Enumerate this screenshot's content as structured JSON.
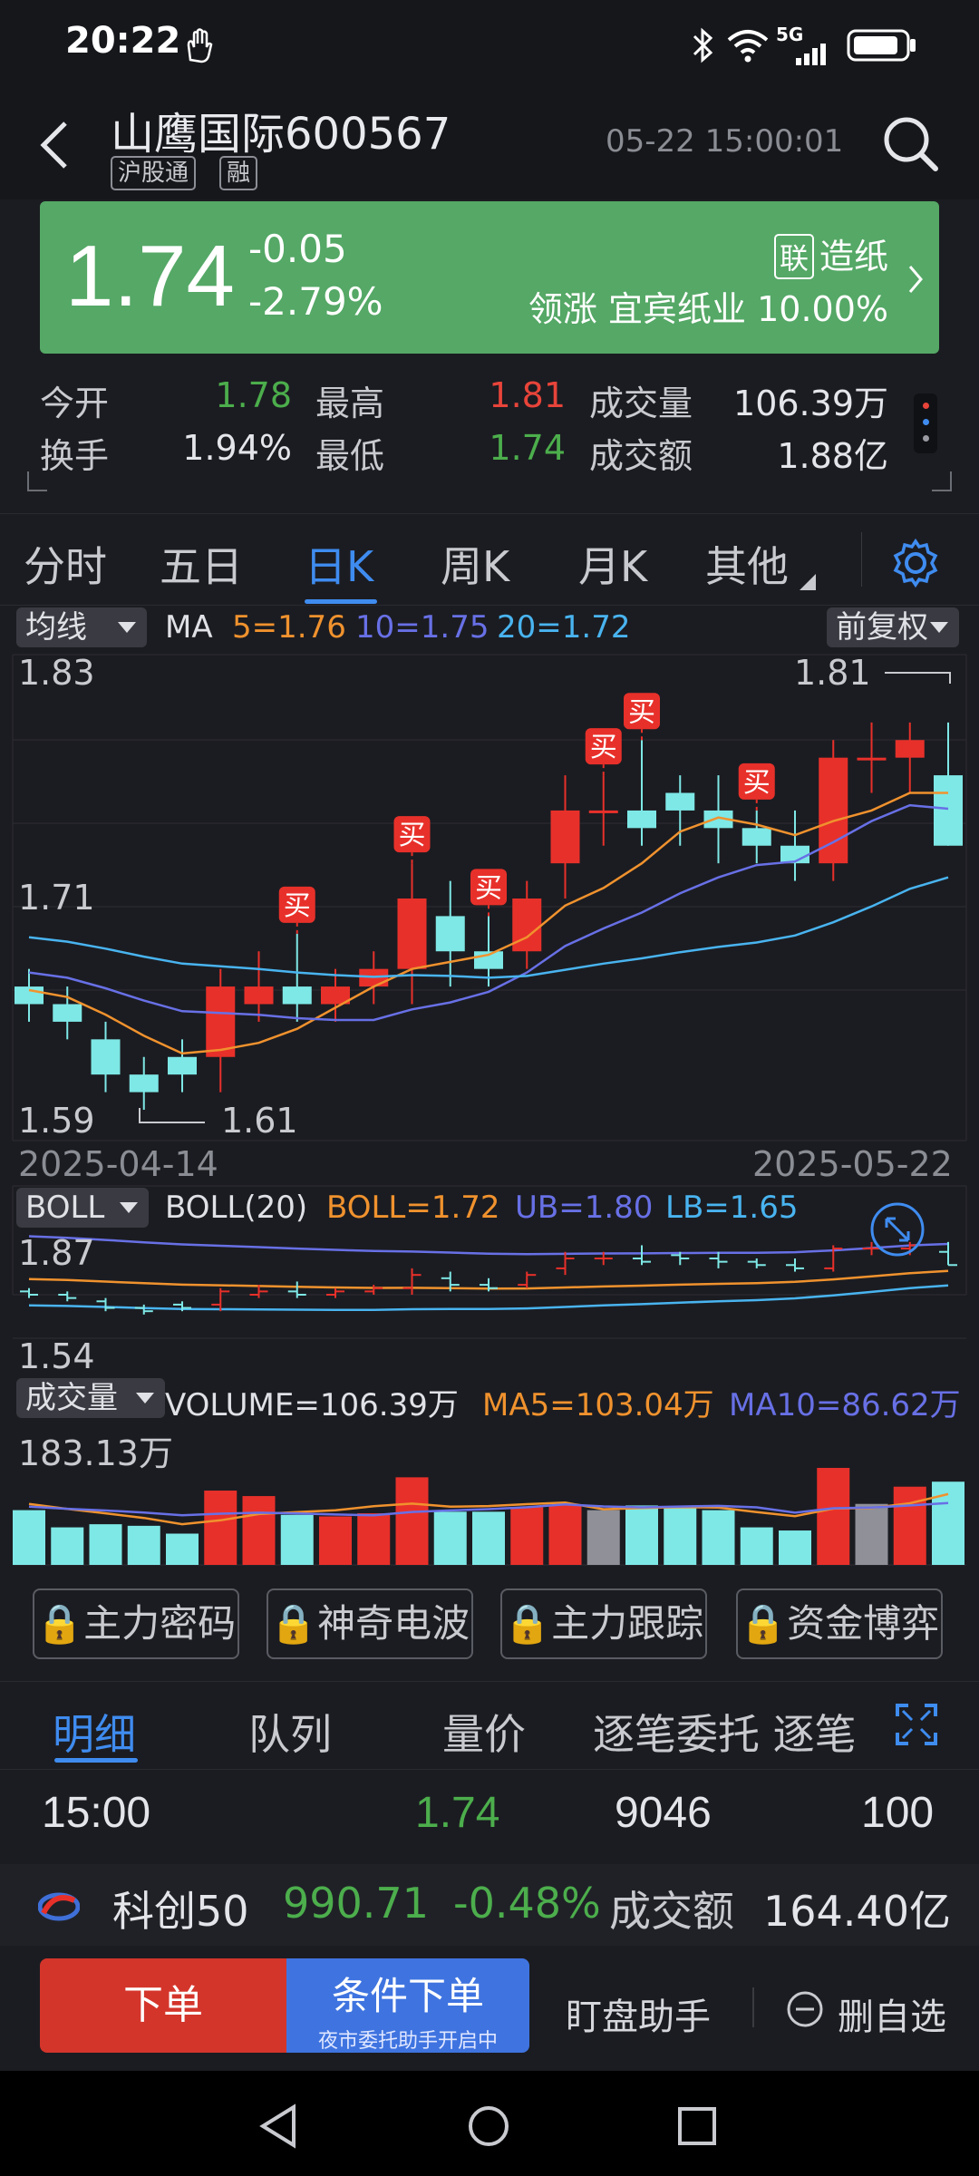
{
  "status_bar": {
    "time": "20:22",
    "network": "5G"
  },
  "header": {
    "stock_name_code": "山鹰国际600567",
    "tag_hgt": "沪股通",
    "tag_rong": "融",
    "datetime": "05-22 15:00:01"
  },
  "price": {
    "last": "1.74",
    "change": "-0.05",
    "change_pct": "-2.79%",
    "sector_tag": "联",
    "sector": "造纸",
    "lead_label": "领涨",
    "lead_stock": "宜宾纸业",
    "lead_pct": "10.00%"
  },
  "stats": {
    "open_label": "今开",
    "open": "1.78",
    "high_label": "最高",
    "high": "1.81",
    "volume_label": "成交量",
    "volume": "106.39万",
    "turnover_label": "换手",
    "turnover": "1.94%",
    "low_label": "最低",
    "low": "1.74",
    "amount_label": "成交额",
    "amount": "1.88亿"
  },
  "tabs": [
    {
      "label": "分时"
    },
    {
      "label": "五日"
    },
    {
      "label": "日K"
    },
    {
      "label": "周K"
    },
    {
      "label": "月K"
    },
    {
      "label": "其他"
    }
  ],
  "active_tab": "日K",
  "kline": {
    "ma_selector": "均线",
    "ma_title": "MA",
    "ma5": "5=1.76",
    "ma10": "10=1.75",
    "ma20": "20=1.72",
    "adjust": "前复权",
    "y_top": "1.83",
    "y_mid": "1.71",
    "y_bottom": "1.59",
    "high_marker": "1.81",
    "low_marker": "1.61",
    "date_start": "2025-04-14",
    "date_end": "2025-05-22",
    "buy_label": "买",
    "colors": {
      "up": "#e8302a",
      "down": "#7ee8e6",
      "ma5": "#f0922e",
      "ma10": "#6870e6",
      "ma20": "#49b4f0"
    }
  },
  "boll": {
    "selector": "BOLL",
    "title": "BOLL(20)",
    "mid": "BOLL=1.72",
    "ub": "UB=1.80",
    "lb": "LB=1.65",
    "y_top": "1.87",
    "y_bottom": "1.54"
  },
  "volume_panel": {
    "selector": "成交量",
    "volume": "VOLUME=106.39万",
    "ma5": "MA5=103.04万",
    "ma10": "MA10=86.62万",
    "y_top": "183.13万"
  },
  "features": [
    {
      "label": "主力密码"
    },
    {
      "label": "神奇电波"
    },
    {
      "label": "主力跟踪"
    },
    {
      "label": "资金博弈"
    }
  ],
  "detail_tabs": [
    {
      "label": "明细"
    },
    {
      "label": "队列"
    },
    {
      "label": "量价"
    },
    {
      "label": "逐笔委托 逐笔"
    }
  ],
  "detail_row": {
    "time": "15:00",
    "price": "1.74",
    "volume": "9046",
    "count": "100"
  },
  "ticker": {
    "name": "科创50",
    "value": "990.71",
    "pct": "-0.48%",
    "amount_label": "成交额",
    "amount": "164.40亿"
  },
  "actions": {
    "order": "下单",
    "cond_order": "条件下单",
    "cond_sub": "夜市委托助手开启中",
    "watch_helper": "盯盘助手",
    "remove_fav": "删自选"
  },
  "chart_data": [
    {
      "type": "candlestick",
      "title": "",
      "x_range": [
        "2025-04-14",
        "2025-05-22"
      ],
      "ylim": [
        1.59,
        1.83
      ],
      "series": [
        {
          "name": "MA5",
          "last": 1.76
        },
        {
          "name": "MA10",
          "last": 1.75
        },
        {
          "name": "MA20",
          "last": 1.72
        }
      ],
      "candles": [
        {
          "o": 1.66,
          "c": 1.65,
          "h": 1.67,
          "l": 1.64
        },
        {
          "o": 1.65,
          "c": 1.64,
          "h": 1.66,
          "l": 1.63
        },
        {
          "o": 1.63,
          "c": 1.61,
          "h": 1.64,
          "l": 1.6
        },
        {
          "o": 1.61,
          "c": 1.6,
          "h": 1.62,
          "l": 1.59
        },
        {
          "o": 1.62,
          "c": 1.61,
          "h": 1.63,
          "l": 1.6
        },
        {
          "o": 1.62,
          "c": 1.66,
          "h": 1.67,
          "l": 1.6
        },
        {
          "o": 1.65,
          "c": 1.66,
          "h": 1.68,
          "l": 1.64
        },
        {
          "o": 1.66,
          "c": 1.65,
          "h": 1.69,
          "l": 1.64
        },
        {
          "o": 1.65,
          "c": 1.66,
          "h": 1.67,
          "l": 1.64
        },
        {
          "o": 1.66,
          "c": 1.67,
          "h": 1.68,
          "l": 1.65
        },
        {
          "o": 1.67,
          "c": 1.71,
          "h": 1.73,
          "l": 1.65
        },
        {
          "o": 1.7,
          "c": 1.68,
          "h": 1.72,
          "l": 1.66
        },
        {
          "o": 1.68,
          "c": 1.67,
          "h": 1.7,
          "l": 1.66
        },
        {
          "o": 1.68,
          "c": 1.71,
          "h": 1.72,
          "l": 1.67
        },
        {
          "o": 1.73,
          "c": 1.76,
          "h": 1.78,
          "l": 1.71
        },
        {
          "o": 1.76,
          "c": 1.76,
          "h": 1.78,
          "l": 1.74
        },
        {
          "o": 1.76,
          "c": 1.75,
          "h": 1.8,
          "l": 1.74
        },
        {
          "o": 1.77,
          "c": 1.76,
          "h": 1.78,
          "l": 1.74
        },
        {
          "o": 1.76,
          "c": 1.75,
          "h": 1.78,
          "l": 1.73
        },
        {
          "o": 1.75,
          "c": 1.74,
          "h": 1.76,
          "l": 1.73
        },
        {
          "o": 1.74,
          "c": 1.73,
          "h": 1.76,
          "l": 1.72
        },
        {
          "o": 1.73,
          "c": 1.79,
          "h": 1.8,
          "l": 1.72
        },
        {
          "o": 1.79,
          "c": 1.79,
          "h": 1.81,
          "l": 1.77
        },
        {
          "o": 1.79,
          "c": 1.8,
          "h": 1.81,
          "l": 1.77
        },
        {
          "o": 1.78,
          "c": 1.74,
          "h": 1.81,
          "l": 1.74
        }
      ]
    },
    {
      "type": "bar",
      "title": "",
      "ylim": [
        0,
        183.13
      ],
      "unit": "万",
      "values": [
        70,
        48,
        52,
        50,
        40,
        95,
        88,
        64,
        62,
        66,
        112,
        68,
        68,
        74,
        76,
        70,
        76,
        74,
        70,
        48,
        44,
        124,
        78,
        100,
        106.39
      ]
    }
  ]
}
